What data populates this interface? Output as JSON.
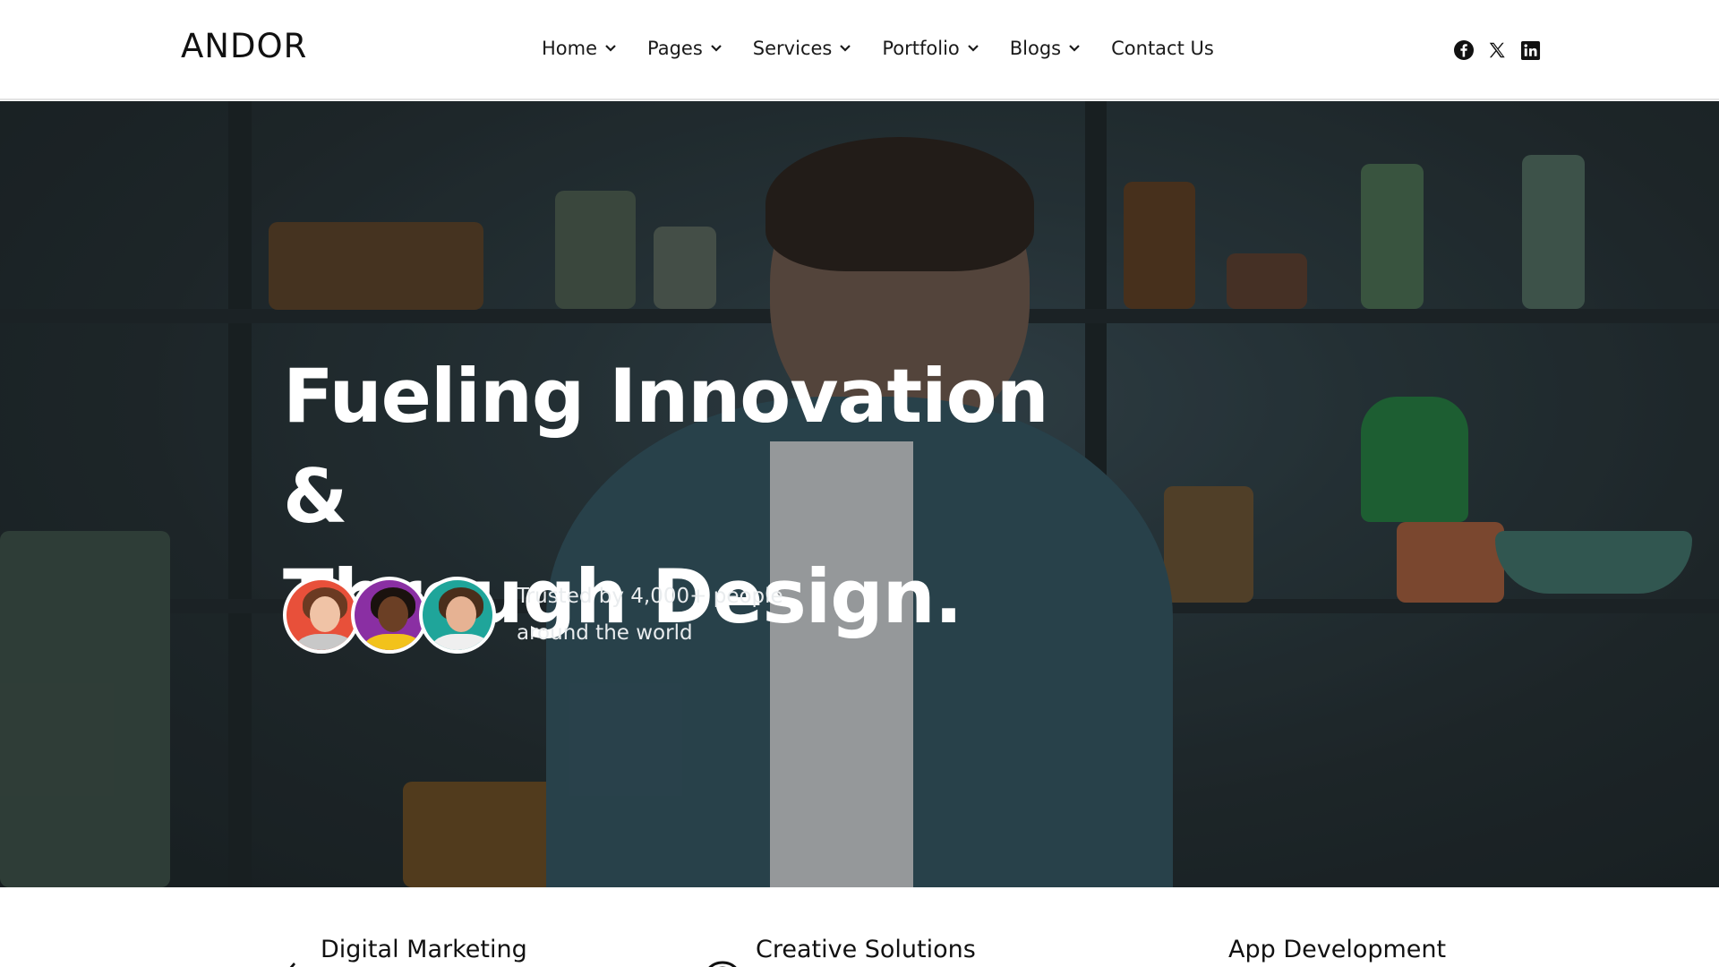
{
  "header": {
    "logo": "ANDOR",
    "nav": [
      {
        "label": "Home",
        "has_dropdown": true
      },
      {
        "label": "Pages",
        "has_dropdown": true
      },
      {
        "label": "Services",
        "has_dropdown": true
      },
      {
        "label": "Portfolio",
        "has_dropdown": true
      },
      {
        "label": "Blogs",
        "has_dropdown": true
      },
      {
        "label": "Contact Us",
        "has_dropdown": false
      }
    ],
    "socials": [
      {
        "icon": "facebook-icon"
      },
      {
        "icon": "x-twitter-icon"
      },
      {
        "icon": "linkedin-icon"
      }
    ]
  },
  "hero": {
    "title_line1": "Fueling Innovation &",
    "title_line2": "Through Design.",
    "trusted_line1": "Trusted by 4,000+ people",
    "trusted_line2": "around the world",
    "avatars": [
      {
        "name": "avatar-1",
        "bg": "#e8503a"
      },
      {
        "name": "avatar-2",
        "bg": "#8a2fa3"
      },
      {
        "name": "avatar-3",
        "bg": "#1fa59a"
      }
    ]
  },
  "services": [
    {
      "title": "Digital Marketing",
      "icon": "marketing-icon"
    },
    {
      "title": "Creative Solutions",
      "icon": "fingerprint-icon"
    },
    {
      "title": "App Development",
      "icon": "diamond-icon"
    }
  ],
  "colors": {
    "text_dark": "#111111",
    "hero_text": "#ffffff",
    "header_bg": "#ffffff"
  }
}
